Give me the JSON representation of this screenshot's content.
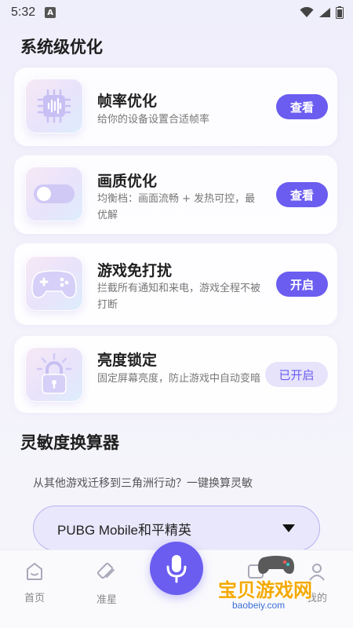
{
  "status_bar": {
    "time": "5:32",
    "notification_badge": "A",
    "icons": [
      "wifi-icon",
      "signal-icon",
      "battery-icon"
    ]
  },
  "system_section": {
    "title": "系统级优化"
  },
  "cards": [
    {
      "title": "帧率优化",
      "description": "给你的设备设置合适帧率",
      "button": "查看",
      "icon": "chip-icon"
    },
    {
      "title": "画质优化",
      "description": "均衡档：画面流畅 + 发热可控，最优解",
      "button": "查看",
      "icon": "toggle-icon"
    },
    {
      "title": "游戏免打扰",
      "description": "拦截所有通知和来电，游戏全程不被打断",
      "button": "开启",
      "icon": "gamepad-icon"
    },
    {
      "title": "亮度锁定",
      "description": "固定屏幕亮度，防止游戏中自动变暗",
      "button": "已开启",
      "icon": "lock-icon"
    }
  ],
  "sensitivity_section": {
    "title": "灵敏度换算器",
    "hint": "从其他游戏迁移到三角洲行动？一键换算灵敏",
    "selected_game": "PUBG Mobile和平精英"
  },
  "bottom_nav": {
    "items": [
      {
        "label": "首页",
        "icon": "home-icon"
      },
      {
        "label": "准星",
        "icon": "crosshair-icon"
      },
      {
        "label": "",
        "icon": "mic-icon"
      },
      {
        "label": "",
        "icon": "tools-icon"
      },
      {
        "label": "我的",
        "icon": "profile-icon"
      }
    ]
  },
  "watermark": {
    "text": "宝贝游戏网",
    "url": "baobeiy.com"
  },
  "colors": {
    "accent": "#6b5df0",
    "accent_light": "#e6e3fb",
    "background": "#f1f0fb"
  }
}
